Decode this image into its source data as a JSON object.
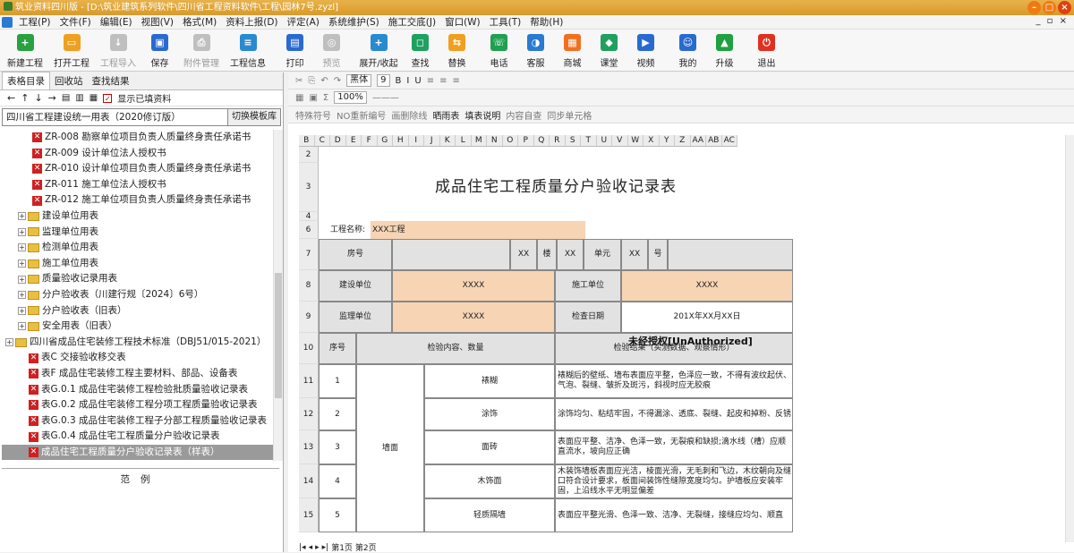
{
  "window": {
    "title": "筑业资料四川版 - [D:\\筑业建筑系列软件\\四川省工程资料软件\\工程\\园林7号.zyzl]"
  },
  "menu": [
    "工程(P)",
    "文件(F)",
    "编辑(E)",
    "视图(V)",
    "格式(M)",
    "资料上报(D)",
    "评定(A)",
    "系统维护(S)",
    "施工交底(J)",
    "窗口(W)",
    "工具(T)",
    "帮助(H)"
  ],
  "toolbar": [
    {
      "label": "新建工程",
      "icon": "plus-icon",
      "color": "#2aa040",
      "enabled": true
    },
    {
      "label": "打开工程",
      "icon": "folder-icon",
      "color": "#f0a020",
      "enabled": true
    },
    {
      "label": "工程导入",
      "icon": "import-icon",
      "color": "#9a9a9a",
      "enabled": false
    },
    {
      "label": "保存",
      "icon": "save-icon",
      "color": "#2a6ad0",
      "enabled": true
    },
    {
      "label": "附件管理",
      "icon": "attachment-icon",
      "color": "#9a9a9a",
      "enabled": false
    },
    {
      "label": "工程信息",
      "icon": "info-icon",
      "color": "#2a8ad0",
      "enabled": true
    },
    {
      "label": "打印",
      "icon": "print-icon",
      "color": "#2a6ad0",
      "enabled": true
    },
    {
      "label": "预览",
      "icon": "preview-icon",
      "color": "#9a9a9a",
      "enabled": false
    },
    {
      "label": "展开/收起",
      "icon": "expand-icon",
      "color": "#2a8ad0",
      "enabled": true
    },
    {
      "label": "查找",
      "icon": "search-icon",
      "color": "#20a060",
      "enabled": true
    },
    {
      "label": "替换",
      "icon": "replace-icon",
      "color": "#f0a020",
      "enabled": true
    },
    {
      "label": "电话",
      "icon": "phone-icon",
      "color": "#20a050",
      "enabled": true
    },
    {
      "label": "客服",
      "icon": "headset-icon",
      "color": "#2a7ad0",
      "enabled": true
    },
    {
      "label": "商城",
      "icon": "shop-icon",
      "color": "#f07020",
      "enabled": true
    },
    {
      "label": "课堂",
      "icon": "class-icon",
      "color": "#20a060",
      "enabled": true
    },
    {
      "label": "视频",
      "icon": "video-icon",
      "color": "#2a6ad0",
      "enabled": true
    },
    {
      "label": "我的",
      "icon": "user-icon",
      "color": "#2a6ad0",
      "enabled": true
    },
    {
      "label": "升级",
      "icon": "upgrade-icon",
      "color": "#20a040",
      "enabled": true
    },
    {
      "label": "退出",
      "icon": "power-icon",
      "color": "#e03020",
      "enabled": true
    }
  ],
  "left": {
    "tabs": [
      "表格目录",
      "回收站",
      "查找结果"
    ],
    "show_filled": "显示已填资料",
    "combo_value": "四川省工程建设统一用表（2020修订版）",
    "switch_btn": "切换模板库",
    "tree": [
      {
        "t": "x",
        "indent": 34,
        "label": "ZR-008 勘察单位项目负责人质量终身责任承诺书"
      },
      {
        "t": "x",
        "indent": 34,
        "label": "ZR-009 设计单位法人授权书"
      },
      {
        "t": "x",
        "indent": 34,
        "label": "ZR-010 设计单位项目负责人质量终身责任承诺书"
      },
      {
        "t": "x",
        "indent": 34,
        "label": "ZR-011 施工单位法人授权书"
      },
      {
        "t": "x",
        "indent": 34,
        "label": "ZR-012 施工单位项目负责人质量终身责任承诺书"
      },
      {
        "t": "f",
        "indent": 18,
        "label": "建设单位用表"
      },
      {
        "t": "f",
        "indent": 18,
        "label": "监理单位用表"
      },
      {
        "t": "f",
        "indent": 18,
        "label": "检测单位用表"
      },
      {
        "t": "f",
        "indent": 18,
        "label": "施工单位用表"
      },
      {
        "t": "f",
        "indent": 18,
        "label": "质量验收记录用表"
      },
      {
        "t": "f",
        "indent": 18,
        "label": "分户验收表（川建行规〔2024〕6号）"
      },
      {
        "t": "f",
        "indent": 18,
        "label": "分户验收表（旧表）"
      },
      {
        "t": "f",
        "indent": 18,
        "label": "安全用表（旧表）"
      },
      {
        "t": "f",
        "indent": 4,
        "label": "四川省成品住宅装修工程技术标准（DBJ51/015-2021）"
      },
      {
        "t": "x",
        "indent": 30,
        "label": "表C 交接验收移交表"
      },
      {
        "t": "x",
        "indent": 30,
        "label": "表F 成品住宅装修工程主要材料、部品、设备表"
      },
      {
        "t": "x",
        "indent": 30,
        "label": "表G.0.1 成品住宅装修工程检验批质量验收记录表"
      },
      {
        "t": "x",
        "indent": 30,
        "label": "表G.0.2 成品住宅装修工程分项工程质量验收记录表"
      },
      {
        "t": "x",
        "indent": 30,
        "label": "表G.0.3 成品住宅装修工程子分部工程质量验收记录表"
      },
      {
        "t": "x",
        "indent": 30,
        "label": "表G.0.4 成品住宅工程质量分户验收记录表"
      },
      {
        "t": "x",
        "indent": 30,
        "label": "成品住宅工程质量分户验收记录表（样表）",
        "sel": true
      }
    ],
    "example_label": "范例"
  },
  "format_bar": {
    "font": "黑体",
    "size": "9",
    "zoom": "100%"
  },
  "action_bar": [
    "特殊符号",
    "NO重新编号",
    "画删除线",
    "晒雨表",
    "填表说明",
    "内容自查",
    "同步单元格"
  ],
  "columns": [
    "B",
    "C",
    "D",
    "E",
    "F",
    "G",
    "H",
    "I",
    "J",
    "K",
    "L",
    "M",
    "N",
    "O",
    "P",
    "Q",
    "R",
    "S",
    "T",
    "U",
    "V",
    "W",
    "X",
    "Y",
    "Z",
    "AA",
    "AB",
    "AC"
  ],
  "sheet": {
    "title": "成品住宅工程质量分户验收记录表",
    "project_label": "工程名称:",
    "project_value": "XXX工程",
    "room": "房号",
    "xx": "XX",
    "lou": "楼",
    "unit": "单元",
    "hao": "号",
    "build_unit": "建设单位",
    "xxxx": "XXXX",
    "const_unit": "施工单位",
    "sup_unit": "监理单位",
    "check_date": "检查日期",
    "date_value": "201X年XX月XX日",
    "seq": "序号",
    "content": "检验内容、数量",
    "result": "检验结果（实测数据、观察情形）",
    "wall": "墙面",
    "rows": [
      {
        "n": "1",
        "item": "裱糊",
        "text": "裱糊后的壁纸、墙布表面应平整，色泽应一致，不得有波纹起伏、气泡、裂缝、皱折及斑污，斜视时应无胶痕"
      },
      {
        "n": "2",
        "item": "涂饰",
        "text": "涂饰均匀、粘结牢固，不得漏涂、透底、裂缝、起皮和掉粉、反锈"
      },
      {
        "n": "3",
        "item": "面砖",
        "text": "表面应平整、洁净、色泽一致，无裂痕和缺损;滴水线（槽）应顺直流水，坡向应正确"
      },
      {
        "n": "4",
        "item": "木饰面",
        "text": "木装饰墙板表面应光洁，棱面光滑，无毛刺和飞边，木纹朝向及缝口符合设计要求，板面间装饰性缝隙宽度均匀。护墙板应安装牢固，上沿线水平无明显偏差"
      },
      {
        "n": "5",
        "item": "轻质隔墙",
        "text": "表面应平整光滑、色泽一致、洁净、无裂缝，接缝应均匀、顺直"
      }
    ],
    "row_labels": [
      "2",
      "3",
      "4",
      "6",
      "7",
      "8",
      "9",
      "10",
      "11",
      "12",
      "13",
      "14",
      "15"
    ],
    "watermark": "未经授权[UnAuthorized]",
    "tabs": [
      "第1页",
      "第2页"
    ]
  }
}
